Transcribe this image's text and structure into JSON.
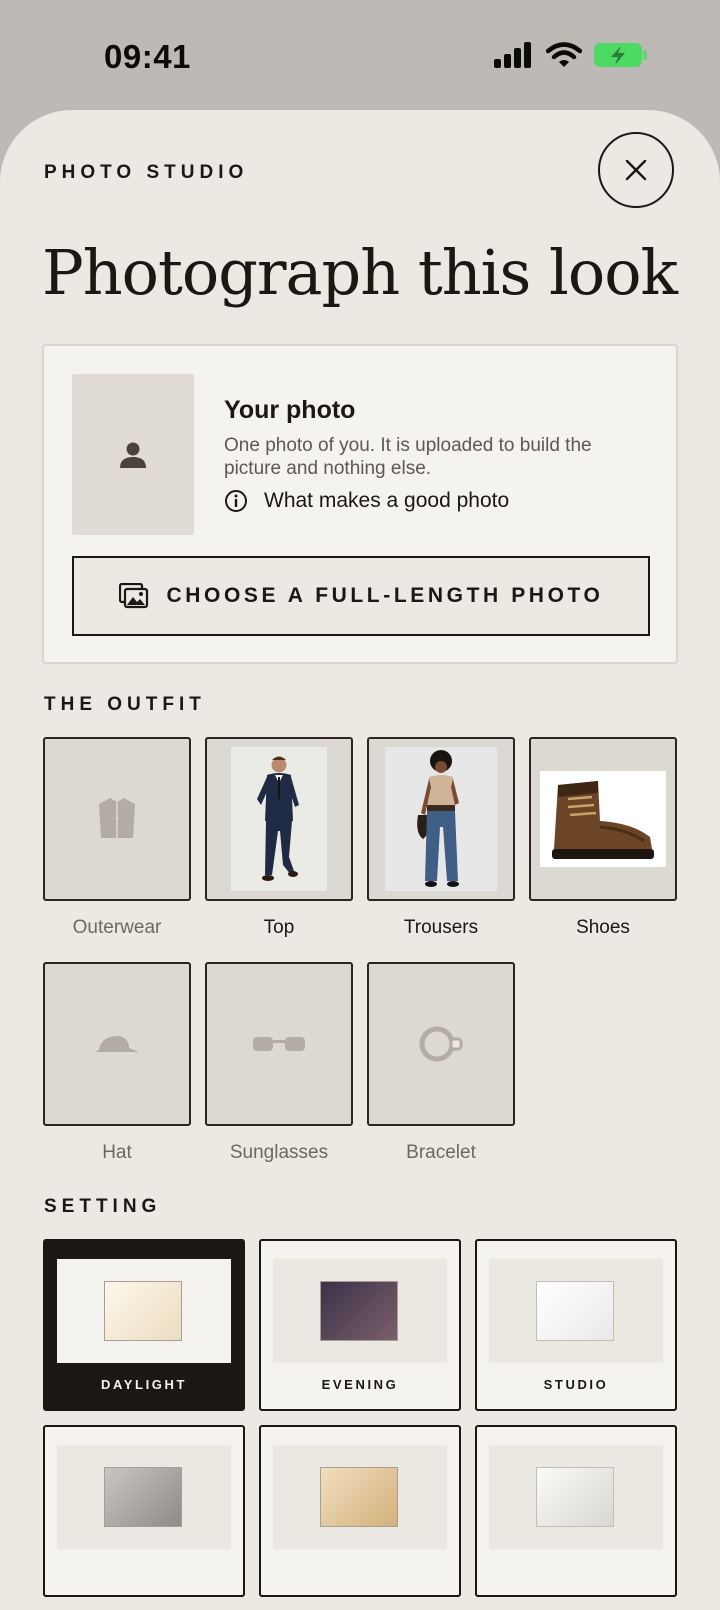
{
  "status_bar": {
    "time": "09:41"
  },
  "sheet": {
    "eyebrow": "PHOTO STUDIO",
    "heading": "Photograph this look"
  },
  "your_photo": {
    "title": "Your photo",
    "description": "One photo of you. It is uploaded to build the picture and nothing else.",
    "tips_link": "What makes a good photo",
    "choose_button": "CHOOSE A FULL-LENGTH PHOTO"
  },
  "outfit": {
    "label": "THE OUTFIT",
    "items": [
      {
        "label": "Outerwear",
        "icon": "jacket-icon",
        "filled": false
      },
      {
        "label": "Top",
        "icon": "suit-photo",
        "filled": true
      },
      {
        "label": "Trousers",
        "icon": "jeans-photo",
        "filled": true
      },
      {
        "label": "Shoes",
        "icon": "boot-photo",
        "filled": true
      },
      {
        "label": "Hat",
        "icon": "cap-icon",
        "filled": false
      },
      {
        "label": "Sunglasses",
        "icon": "sunglasses-icon",
        "filled": false
      },
      {
        "label": "Bracelet",
        "icon": "bracelet-icon",
        "filled": false
      }
    ]
  },
  "setting": {
    "label": "SETTING",
    "options": [
      {
        "label": "DAYLIGHT",
        "selected": true
      },
      {
        "label": "EVENING",
        "selected": false
      },
      {
        "label": "STUDIO",
        "selected": false
      },
      {
        "label": "",
        "selected": false
      },
      {
        "label": "",
        "selected": false
      },
      {
        "label": "",
        "selected": false
      }
    ]
  },
  "colors": {
    "background": "#ece8e2",
    "ink": "#1b1714",
    "tile": "#dcd8d2",
    "battery": "#4cd964"
  }
}
